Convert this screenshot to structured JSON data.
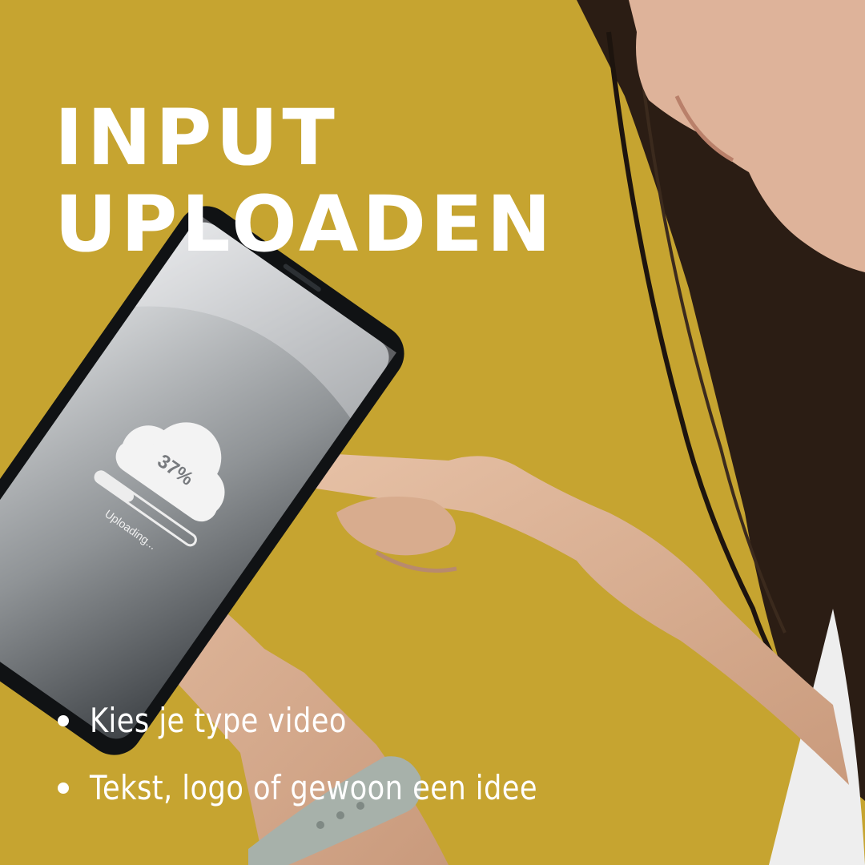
{
  "title": {
    "line1": "INPUT",
    "line2": "UPLOADEN"
  },
  "bullets": [
    {
      "text": "Kies je type video"
    },
    {
      "text": "Tekst, logo of gewoon een idee"
    }
  ],
  "phone_screen": {
    "percent": "37%",
    "status": "Uploading...",
    "progress": 0.37
  },
  "colors": {
    "background": "#c6a430",
    "text": "#ffffff",
    "watch_band": "#a7b1aa"
  }
}
